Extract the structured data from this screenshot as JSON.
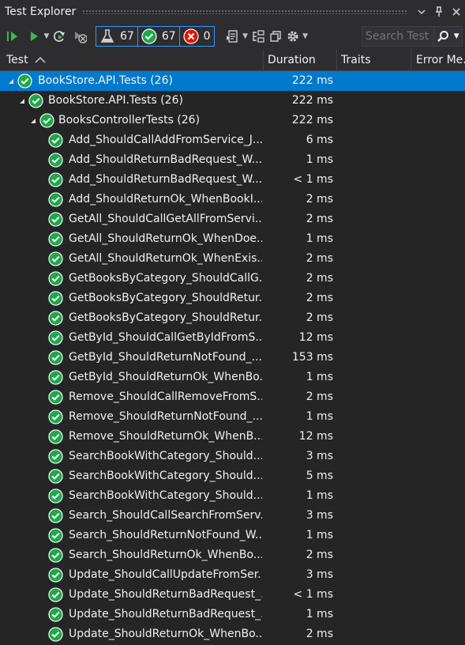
{
  "window": {
    "title": "Test Explorer",
    "pin": "⊥",
    "close": "✕"
  },
  "toolbar": {
    "counts": {
      "total": "67",
      "passed": "67",
      "failed": "0"
    },
    "search_placeholder": "Search Test E"
  },
  "columns": [
    "Test",
    "Duration",
    "Traits",
    "Error Me..."
  ],
  "colors": {
    "accent": "#007acc",
    "pass": "#1fa84a",
    "fail": "#e51400",
    "background": "#252526"
  },
  "tree": [
    {
      "name": "BookStore.API.Tests  (26)",
      "duration": "222 ms",
      "level": 0,
      "expanded": true,
      "selected": true
    },
    {
      "name": "BookStore.API.Tests  (26)",
      "duration": "222 ms",
      "level": 1,
      "expanded": true
    },
    {
      "name": "BooksControllerTests  (26)",
      "duration": "222 ms",
      "level": 2,
      "expanded": true
    },
    {
      "name": "Add_ShouldCallAddFromService_J...",
      "duration": "6 ms",
      "level": 3
    },
    {
      "name": "Add_ShouldReturnBadRequest_W...",
      "duration": "1 ms",
      "level": 3
    },
    {
      "name": "Add_ShouldReturnBadRequest_W...",
      "duration": "< 1 ms",
      "level": 3
    },
    {
      "name": "Add_ShouldReturnOk_WhenBookI...",
      "duration": "2 ms",
      "level": 3
    },
    {
      "name": "GetAll_ShouldCallGetAllFromServi...",
      "duration": "2 ms",
      "level": 3
    },
    {
      "name": "GetAll_ShouldReturnOk_WhenDoe...",
      "duration": "1 ms",
      "level": 3
    },
    {
      "name": "GetAll_ShouldReturnOk_WhenExis...",
      "duration": "2 ms",
      "level": 3
    },
    {
      "name": "GetBooksByCategory_ShouldCallG...",
      "duration": "2 ms",
      "level": 3
    },
    {
      "name": "GetBooksByCategory_ShouldRetur...",
      "duration": "2 ms",
      "level": 3
    },
    {
      "name": "GetBooksByCategory_ShouldRetur...",
      "duration": "2 ms",
      "level": 3
    },
    {
      "name": "GetById_ShouldCallGetByIdFromS...",
      "duration": "12 ms",
      "level": 3
    },
    {
      "name": "GetById_ShouldReturnNotFound_...",
      "duration": "153 ms",
      "level": 3
    },
    {
      "name": "GetById_ShouldReturnOk_WhenBo...",
      "duration": "1 ms",
      "level": 3
    },
    {
      "name": "Remove_ShouldCallRemoveFromS...",
      "duration": "2 ms",
      "level": 3
    },
    {
      "name": "Remove_ShouldReturnNotFound_...",
      "duration": "1 ms",
      "level": 3
    },
    {
      "name": "Remove_ShouldReturnOk_WhenB...",
      "duration": "12 ms",
      "level": 3
    },
    {
      "name": "SearchBookWithCategory_Should...",
      "duration": "3 ms",
      "level": 3
    },
    {
      "name": "SearchBookWithCategory_Should...",
      "duration": "5 ms",
      "level": 3
    },
    {
      "name": "SearchBookWithCategory_Should...",
      "duration": "1 ms",
      "level": 3
    },
    {
      "name": "Search_ShouldCallSearchFromServ...",
      "duration": "3 ms",
      "level": 3
    },
    {
      "name": "Search_ShouldReturnNotFound_W...",
      "duration": "1 ms",
      "level": 3
    },
    {
      "name": "Search_ShouldReturnOk_WhenBo...",
      "duration": "2 ms",
      "level": 3
    },
    {
      "name": "Update_ShouldCallUpdateFromSer...",
      "duration": "3 ms",
      "level": 3
    },
    {
      "name": "Update_ShouldReturnBadRequest_...",
      "duration": "< 1 ms",
      "level": 3
    },
    {
      "name": "Update_ShouldReturnBadRequest_...",
      "duration": "1 ms",
      "level": 3
    },
    {
      "name": "Update_ShouldReturnOk_WhenBo...",
      "duration": "2 ms",
      "level": 3
    }
  ]
}
